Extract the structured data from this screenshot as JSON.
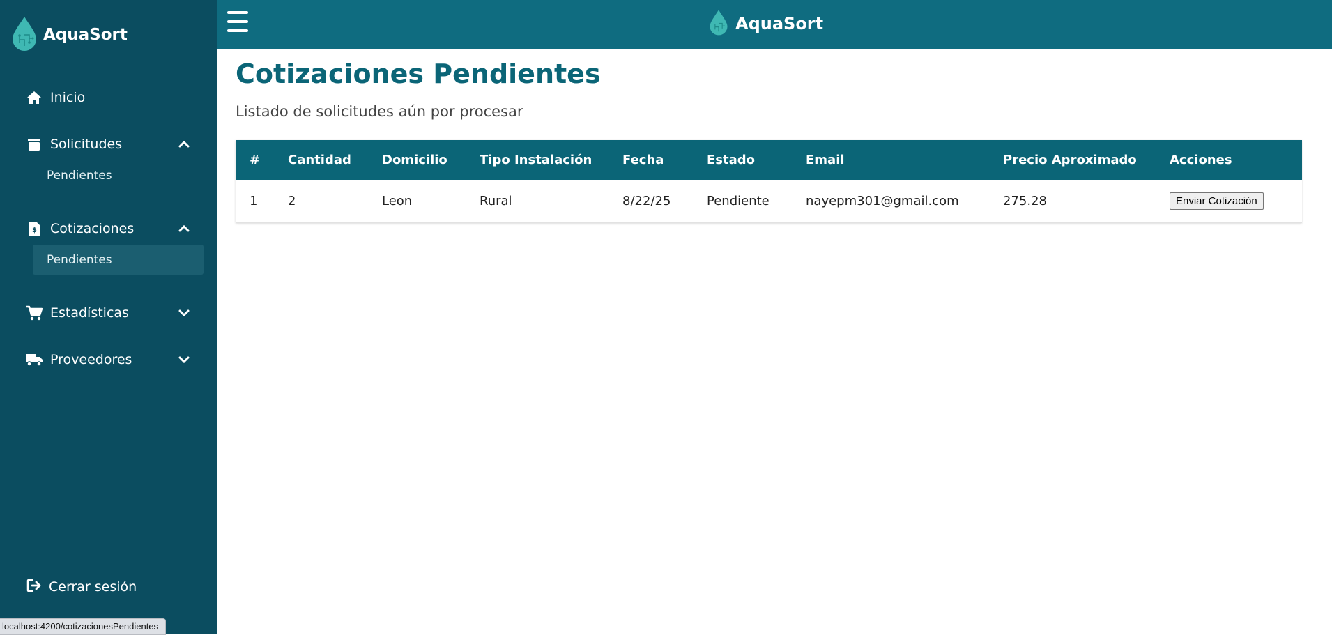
{
  "app": {
    "brand": "AquaSort"
  },
  "sidebar": {
    "items": [
      {
        "label": "Inicio",
        "icon": "home-icon"
      },
      {
        "label": "Solicitudes",
        "icon": "box-icon",
        "expanded": true,
        "sub": [
          "Pendientes"
        ]
      },
      {
        "label": "Cotizaciones",
        "icon": "invoice-icon",
        "expanded": true,
        "sub": [
          "Pendientes"
        ]
      },
      {
        "label": "Estadísticas",
        "icon": "cart-icon",
        "expanded": false
      },
      {
        "label": "Proveedores",
        "icon": "truck-icon",
        "expanded": false
      }
    ],
    "logout": "Cerrar sesión"
  },
  "status_bar": {
    "url": "localhost:4200/cotizacionesPendientes"
  },
  "page": {
    "title": "Cotizaciones Pendientes",
    "subtitle": "Listado de solicitudes aún por procesar"
  },
  "table": {
    "headers": [
      "#",
      "Cantidad",
      "Domicilio",
      "Tipo Instalación",
      "Fecha",
      "Estado",
      "Email",
      "Precio Aproximado",
      "Acciones"
    ],
    "rows": [
      {
        "num": "1",
        "cantidad": "2",
        "domicilio": "Leon",
        "tipo": "Rural",
        "fecha": "8/22/25",
        "estado": "Pendiente",
        "email": "nayepm301@gmail.com",
        "precio": "275.28",
        "accion": "Enviar Cotización"
      }
    ]
  },
  "colors": {
    "sidebar_bg": "#0b4d60",
    "topbar_bg": "#0f6c80",
    "accent": "#0b6577",
    "drop": "#3fb8b3"
  }
}
